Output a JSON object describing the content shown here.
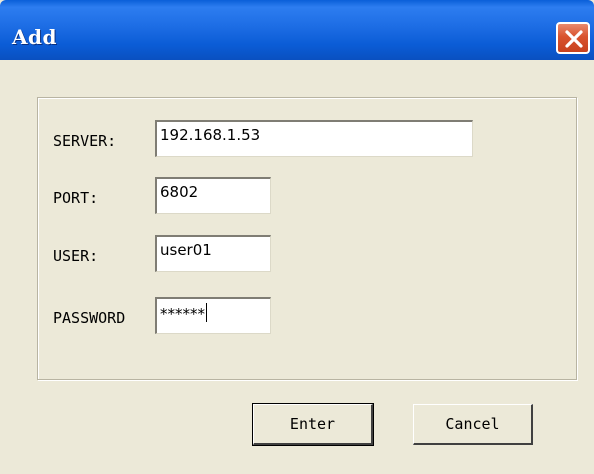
{
  "window": {
    "title": "Add",
    "close_icon": "close-x-icon",
    "accent_title": "#0b5cd6",
    "accent_close": "#d9532e"
  },
  "form": {
    "server": {
      "label": "SERVER:",
      "value": "192.168.1.53"
    },
    "port": {
      "label": "PORT:",
      "value": "6802"
    },
    "user": {
      "label": "USER:",
      "value": "user01"
    },
    "password": {
      "label": "PASSWORD",
      "value": "******"
    }
  },
  "buttons": {
    "enter": "Enter",
    "cancel": "Cancel"
  }
}
